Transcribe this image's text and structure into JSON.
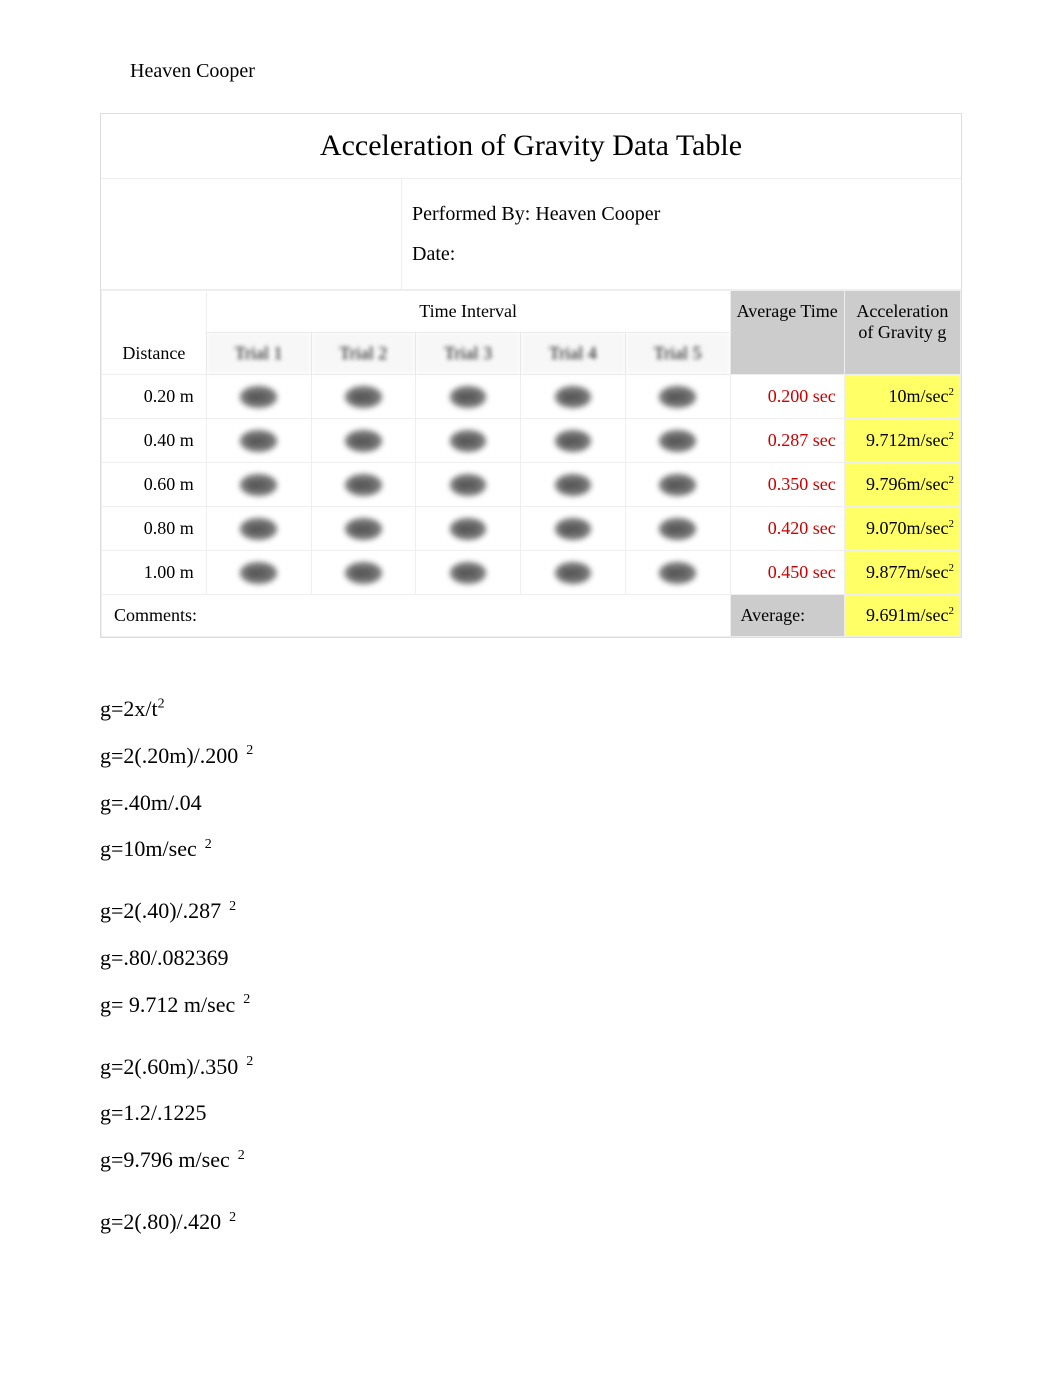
{
  "author": "Heaven Cooper",
  "table": {
    "title": "Acceleration of Gravity Data Table",
    "performed_by_label": "Performed By:",
    "performed_by_value": "Heaven Cooper",
    "date_label": "Date:",
    "date_value": "",
    "headers": {
      "distance": "Distance",
      "time_interval": "Time Interval",
      "trial1": "Trial 1",
      "trial2": "Trial 2",
      "trial3": "Trial 3",
      "trial4": "Trial 4",
      "trial5": "Trial 5",
      "avg_time": "Average Time",
      "accel": "Acceleration of Gravity g"
    },
    "rows": [
      {
        "distance": "0.20 m",
        "t1": "sec",
        "t2": "sec",
        "t3": "sec",
        "t4": "sec",
        "t5": "sec",
        "avg": "0.200 sec",
        "accel": "10m/sec"
      },
      {
        "distance": "0.40 m",
        "t1": "sec",
        "t2": "sec",
        "t3": "sec",
        "t4": "sec",
        "t5": "sec",
        "avg": "0.287 sec",
        "accel": "9.712m/sec"
      },
      {
        "distance": "0.60 m",
        "t1": "sec",
        "t2": "sec",
        "t3": "sec",
        "t4": "sec",
        "t5": "sec",
        "avg": "0.350 sec",
        "accel": "9.796m/sec"
      },
      {
        "distance": "0.80 m",
        "t1": "sec",
        "t2": "sec",
        "t3": "sec",
        "t4": "sec",
        "t5": "sec",
        "avg": "0.420 sec",
        "accel": "9.070m/sec"
      },
      {
        "distance": "1.00 m",
        "t1": "sec",
        "t2": "sec",
        "t3": "sec",
        "t4": "sec",
        "t5": "sec",
        "avg": "0.450 sec",
        "accel": "9.877m/sec"
      }
    ],
    "comments_label": "Comments:",
    "average_label": "Average:",
    "average_value": "9.691m/sec"
  },
  "calculations": {
    "formula": "g=2x/t",
    "group1": {
      "line1": "g=2(.20m)/.200",
      "line2": "g=.40m/.04",
      "line3": "g=10m/sec"
    },
    "group2": {
      "line1": "g=2(.40)/.287",
      "line2": "g=.80/.082369",
      "line3": "g= 9.712 m/sec"
    },
    "group3": {
      "line1": "g=2(.60m)/.350",
      "line2": "g=1.2/.1225",
      "line3": "g=9.796 m/sec"
    },
    "group4": {
      "line1": "g=2(.80)/.420"
    }
  },
  "sup2": "2"
}
